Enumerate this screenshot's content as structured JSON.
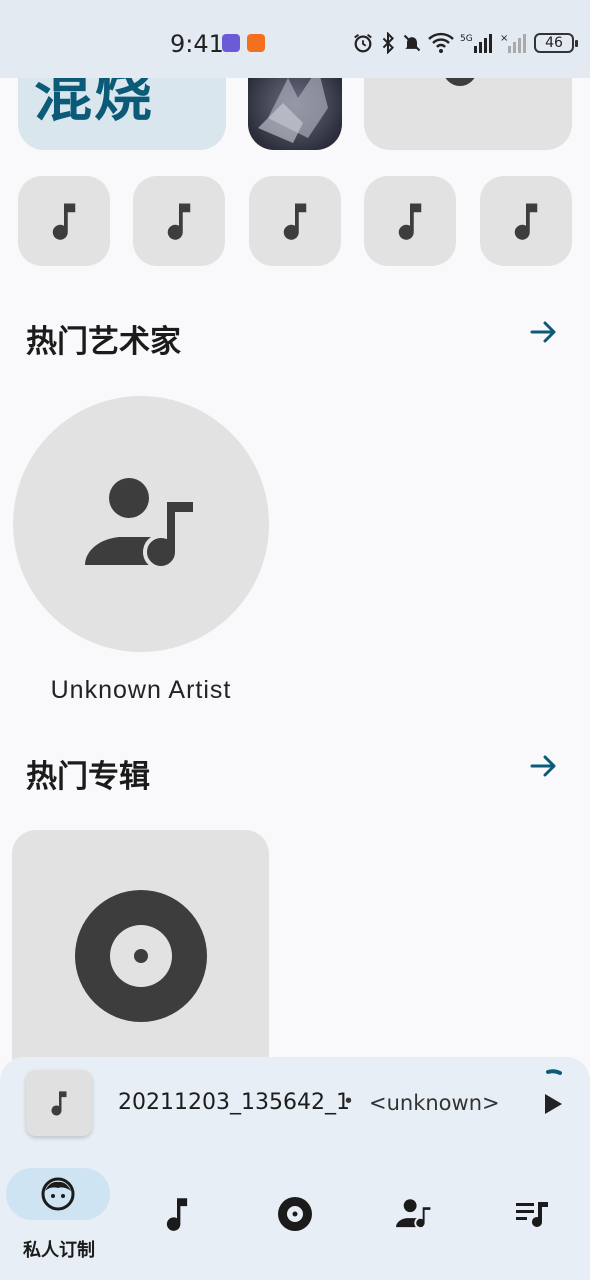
{
  "status_bar": {
    "time": "9:41",
    "battery": "46",
    "network": "5G",
    "icons": [
      "app-icon-1",
      "app-icon-2",
      "alarm-icon",
      "bluetooth-icon",
      "mute-icon",
      "wifi-icon",
      "signal-icon",
      "signal-off-icon",
      "battery-icon"
    ]
  },
  "top_row": {
    "text_tile": "混烧"
  },
  "small_tiles": [
    {
      "icon": "music-note-icon"
    },
    {
      "icon": "music-note-icon"
    },
    {
      "icon": "music-note-icon"
    },
    {
      "icon": "music-note-icon"
    },
    {
      "icon": "music-note-icon"
    }
  ],
  "sections": {
    "artists": {
      "title": "热门艺术家",
      "items": [
        {
          "name": "Unknown Artist",
          "icon": "artist-icon"
        }
      ]
    },
    "albums": {
      "title": "热门专辑",
      "items": [
        {
          "icon": "album-disc-icon"
        }
      ]
    }
  },
  "mini_player": {
    "title": "20211203_135642_1",
    "separator": "•",
    "artist": "<unknown>"
  },
  "bottom_nav": {
    "active_label": "私人订制",
    "items": [
      {
        "icon": "face-icon",
        "label": "私人订制",
        "active": true
      },
      {
        "icon": "music-note-icon",
        "label": ""
      },
      {
        "icon": "album-disc-icon",
        "label": ""
      },
      {
        "icon": "artist-icon",
        "label": ""
      },
      {
        "icon": "playlist-icon",
        "label": ""
      }
    ]
  },
  "colors": {
    "accent": "#0b5a78",
    "tile": "#e2e2e2",
    "nav_active": "#cfe4f3",
    "background": "#f9f9fc"
  }
}
